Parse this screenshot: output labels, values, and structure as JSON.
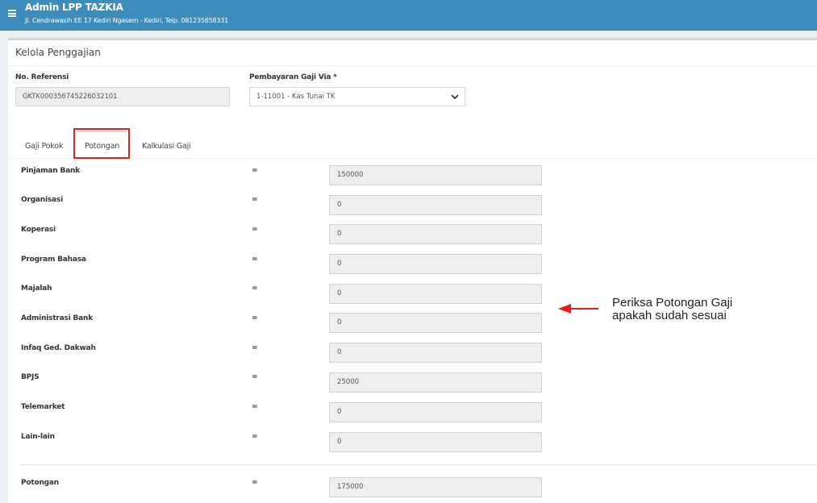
{
  "header": {
    "title": "Admin LPP TAZKIA",
    "address": "Jl. Cendrawasih EE 17 Kediri Ngasem - Kediri, Telp. 081235858331"
  },
  "page": {
    "title": "Kelola Penggajian"
  },
  "form": {
    "no_referensi_label": "No. Referensi",
    "no_referensi_value": "GKTK000356745226032101",
    "pembayaran_label": "Pembayaran Gaji Via *",
    "pembayaran_value": "1-11001 - Kas Tunai TK"
  },
  "tabs": [
    {
      "label": "Gaji Pokok",
      "active": false
    },
    {
      "label": "Potongan",
      "active": true
    },
    {
      "label": "Kalkulasi Gaji",
      "active": false
    }
  ],
  "potongan": {
    "rows": [
      {
        "label": "Pinjaman Bank",
        "eq": "=",
        "value": "150000"
      },
      {
        "label": "Organisasi",
        "eq": "=",
        "value": "0"
      },
      {
        "label": "Koperasi",
        "eq": "=",
        "value": "0"
      },
      {
        "label": "Program Bahasa",
        "eq": "=",
        "value": "0"
      },
      {
        "label": "Majalah",
        "eq": "=",
        "value": "0"
      },
      {
        "label": "Administrasi Bank",
        "eq": "=",
        "value": "0"
      },
      {
        "label": "Infaq Ged. Dakwah",
        "eq": "=",
        "value": "0"
      },
      {
        "label": "BPJS",
        "eq": "=",
        "value": "25000"
      },
      {
        "label": "Telemarket",
        "eq": "=",
        "value": "0"
      },
      {
        "label": "Lain-lain",
        "eq": "=",
        "value": "0"
      }
    ],
    "total": {
      "label": "Potongan",
      "eq": "=",
      "value": "175000"
    }
  },
  "annotation": {
    "line1": "Periksa Potongan Gaji",
    "line2": "apakah sudah sesuai",
    "color": "#e81c1c"
  },
  "colors": {
    "header": "#3c8dbc",
    "highlight": "#e81c1c"
  }
}
